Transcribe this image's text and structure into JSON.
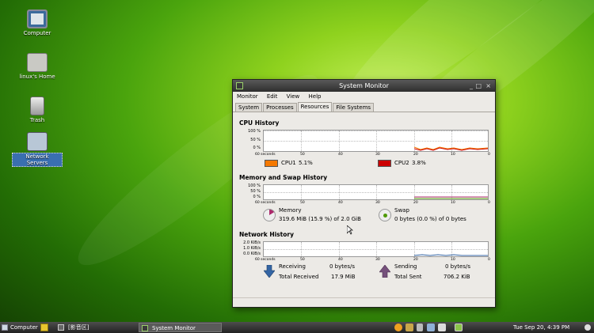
{
  "desktop": {
    "icons": [
      {
        "label": "Computer",
        "icon": "computer-icon"
      },
      {
        "label": "linux's Home",
        "icon": "home-folder-icon"
      },
      {
        "label": "Trash",
        "icon": "trash-icon"
      },
      {
        "label": "Network Servers",
        "icon": "network-servers-icon"
      }
    ]
  },
  "window": {
    "title": "System Monitor",
    "controls": {
      "minimize": "_",
      "maximize": "□",
      "close": "×"
    },
    "menu": [
      "Monitor",
      "Edit",
      "View",
      "Help"
    ],
    "tabs": [
      "System",
      "Processes",
      "Resources",
      "File Systems"
    ],
    "active_tab": "Resources"
  },
  "cpu": {
    "heading": "CPU History",
    "y_ticks": [
      "100 %",
      "50 %",
      "0 %"
    ],
    "x_ticks": [
      "60 seconds",
      "50",
      "40",
      "30",
      "20",
      "10",
      "0"
    ],
    "cpu1": {
      "label": "CPU1",
      "value": "5.1%",
      "color": "#f57900"
    },
    "cpu2": {
      "label": "CPU2",
      "value": "3.8%",
      "color": "#cc0000"
    }
  },
  "memory": {
    "heading": "Memory and Swap History",
    "y_ticks": [
      "100 %",
      "50 %",
      "0 %"
    ],
    "x_ticks": [
      "60 seconds",
      "50",
      "40",
      "30",
      "20",
      "10",
      "0"
    ],
    "mem_label": "Memory",
    "mem_value": "319.6 MiB (15.9 %) of 2.0 GiB",
    "mem_color": "#ad2a6c",
    "swap_label": "Swap",
    "swap_value": "0 bytes (0.0 %) of 0 bytes",
    "swap_color": "#4e9a06"
  },
  "network": {
    "heading": "Network History",
    "y_ticks": [
      "2.0 KiB/s",
      "1.0 KiB/s",
      "0.0 KiB/s"
    ],
    "x_ticks": [
      "60 seconds",
      "50",
      "40",
      "30",
      "20",
      "10",
      "0"
    ],
    "receiving_label": "Receiving",
    "receiving_value": "0 bytes/s",
    "total_received_label": "Total Received",
    "total_received_value": "17.9 MiB",
    "sending_label": "Sending",
    "sending_value": "0 bytes/s",
    "total_sent_label": "Total Sent",
    "total_sent_value": "706.2 KiB",
    "receiving_color": "#3465a4",
    "sending_color": "#75507b"
  },
  "taskbar": {
    "computer_menu": "Computer",
    "workspace": "[影音区]",
    "task": "System Monitor",
    "clock": "Tue Sep 20,  4:39 PM"
  }
}
